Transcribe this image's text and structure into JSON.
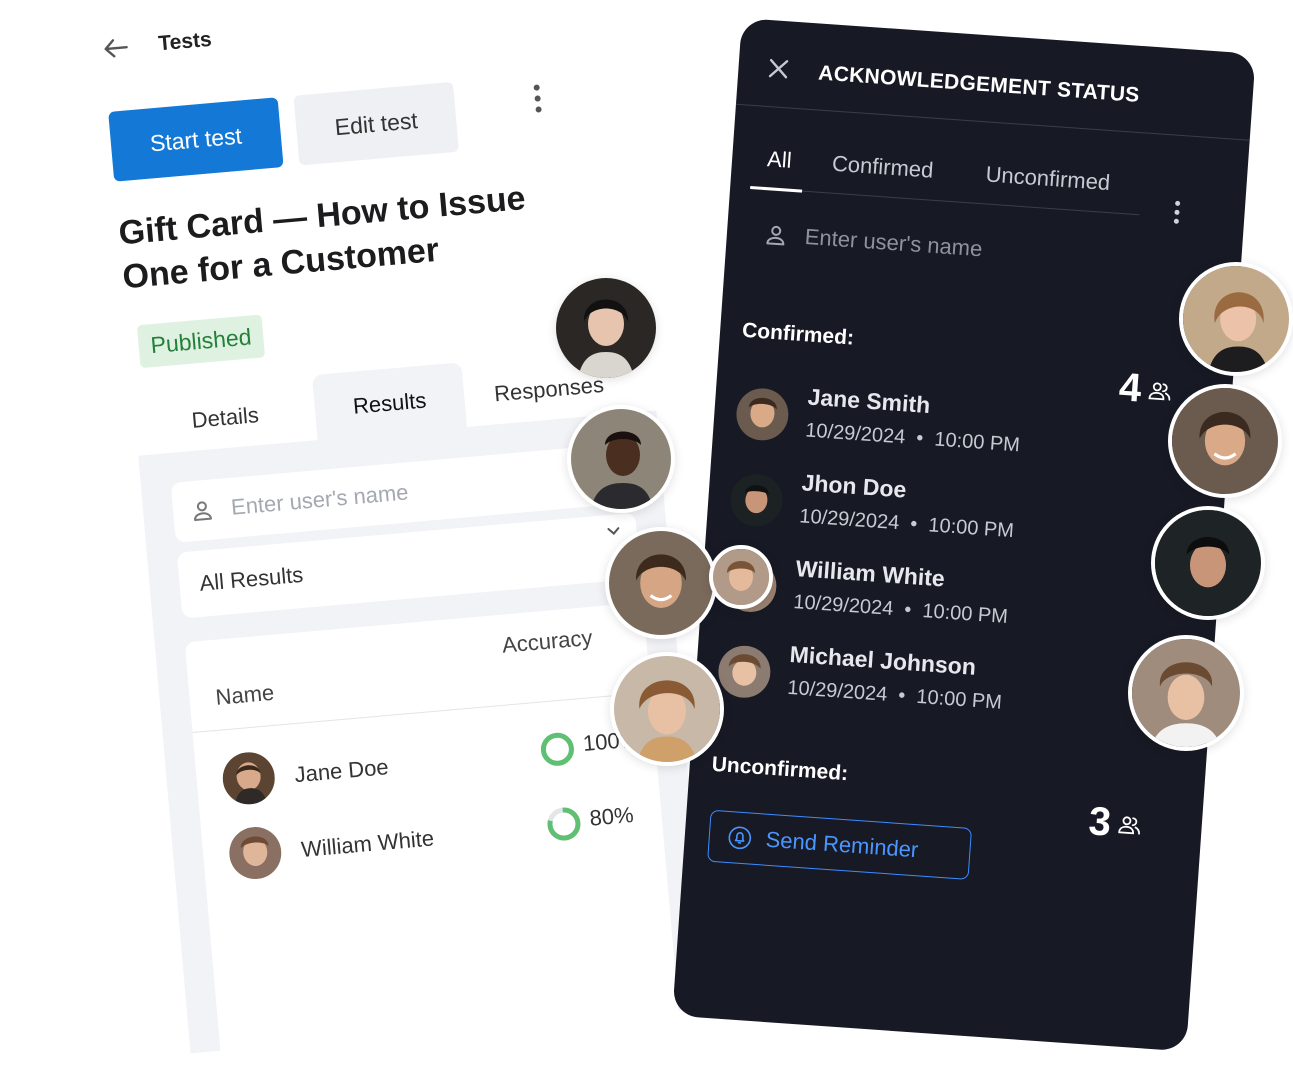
{
  "left_panel": {
    "header_title": "Tests",
    "start_button": "Start test",
    "edit_button": "Edit test",
    "test_title": "Gift Card — How to Issue One for a Customer",
    "status_badge": "Published",
    "tabs": [
      {
        "label": "Details"
      },
      {
        "label": "Results",
        "active": true
      },
      {
        "label": "Responses"
      }
    ],
    "search_placeholder": "Enter user's name",
    "filter_value": "All Results",
    "table": {
      "columns": [
        "Name",
        "Accuracy"
      ],
      "rows": [
        {
          "name": "Jane Doe",
          "accuracy": "100%",
          "accuracy_value": 1.0
        },
        {
          "name": "William White",
          "accuracy": "80%",
          "accuracy_value": 0.8
        }
      ]
    },
    "colors": {
      "accent": "#1479d6",
      "success": "#5fbf72"
    }
  },
  "right_panel": {
    "title": "ACKNOWLEDGEMENT STATUS",
    "tabs": [
      {
        "label": "All",
        "active": true
      },
      {
        "label": "Confirmed"
      },
      {
        "label": "Unconfirmed"
      }
    ],
    "search_placeholder": "Enter user's name",
    "confirmed": {
      "label": "Confirmed:",
      "count": "4",
      "users": [
        {
          "name": "Jane Smith",
          "date": "10/29/2024",
          "time": "10:00 PM"
        },
        {
          "name": "Jhon Doe",
          "date": "10/29/2024",
          "time": "10:00 PM"
        },
        {
          "name": "William White",
          "date": "10/29/2024",
          "time": "10:00 PM"
        },
        {
          "name": "Michael Johnson",
          "date": "10/29/2024",
          "time": "10:00 PM"
        }
      ]
    },
    "unconfirmed": {
      "label": "Unconfirmed:",
      "count": "3"
    },
    "reminder_button": "Send Reminder",
    "colors": {
      "background": "#171a24",
      "link": "#4a96ff"
    }
  },
  "icons": [
    "arrow-left-icon",
    "more-vertical-icon",
    "user-icon",
    "chevron-down-icon",
    "close-icon",
    "group-icon",
    "bell-icon"
  ]
}
